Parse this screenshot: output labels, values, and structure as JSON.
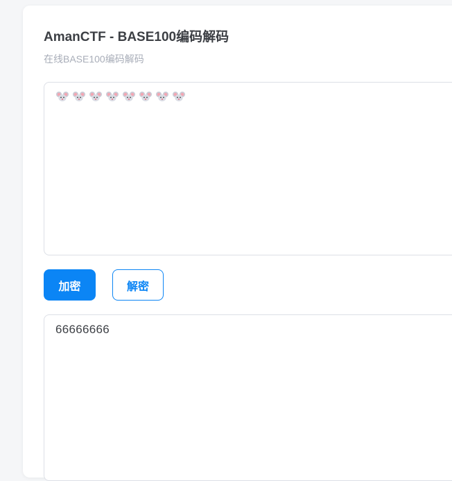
{
  "title": "AmanCTF - BASE100编码解码",
  "subtitle": "在线BASE100编码解码",
  "input": {
    "emoji_name": "mouse-face-icon",
    "count": 8
  },
  "buttons": {
    "encrypt_label": "加密",
    "decrypt_label": "解密"
  },
  "output": {
    "value": "66666666"
  },
  "colors": {
    "accent": "#0b85f5",
    "title": "#3c3f44",
    "subtitle": "#a8adb8",
    "border": "#dcdfe6"
  }
}
